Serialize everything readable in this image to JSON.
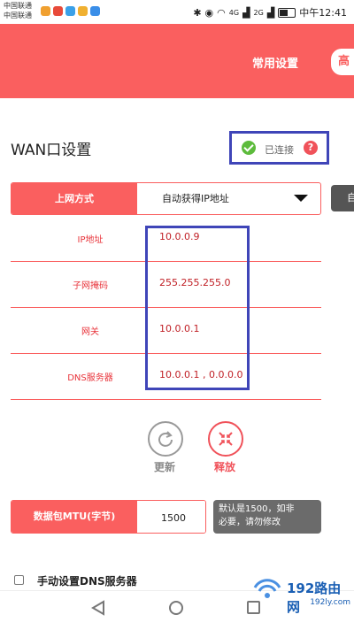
{
  "statusbar": {
    "carrier_1": "中国联通",
    "carrier_2": "中国联通",
    "network_1": "4G",
    "network_2": "2G",
    "time": "中午12:41",
    "app_icon_colors": [
      "#f0a030",
      "#e84a3a",
      "#3aa0e8",
      "#f0b030",
      "#3a8ee8"
    ]
  },
  "header": {
    "background": "#fa5f5f",
    "nav_common": "常用设置",
    "nav_advanced": "高"
  },
  "page": {
    "title": "WAN口设置"
  },
  "status": {
    "text": "已连接",
    "ok_icon": "check-circle-icon",
    "help_icon": "question-circle-icon",
    "help_symbol": "?"
  },
  "connection": {
    "label": "上网方式",
    "value": "自动获得IP地址",
    "side_button": "自"
  },
  "info": [
    {
      "label": "IP地址",
      "value": "10.0.0.9"
    },
    {
      "label": "子网掩码",
      "value": "255.255.255.0"
    },
    {
      "label": "网关",
      "value": "10.0.0.1"
    },
    {
      "label": "DNS服务器",
      "value": "10.0.0.1 , 0.0.0.0"
    }
  ],
  "actions": {
    "refresh_label": "更新",
    "release_label": "释放",
    "refresh_icon": "refresh-icon",
    "release_icon": "release-icon"
  },
  "mtu": {
    "label": "数据包MTU(字节)",
    "value": "1500",
    "tip_line1": "默认是1500，如非",
    "tip_line2": "必要，请勿修改"
  },
  "dns_manual": {
    "label": "手动设置DNS服务器",
    "checked": false
  },
  "watermark": {
    "main": "192路由网",
    "sub": "192ly.com"
  },
  "colors": {
    "accent": "#fa5f5f",
    "label_red": "#e8333a",
    "value_red": "#c01f25",
    "highlight_box": "#3f45b8",
    "ok_green": "#5dbb3c"
  }
}
